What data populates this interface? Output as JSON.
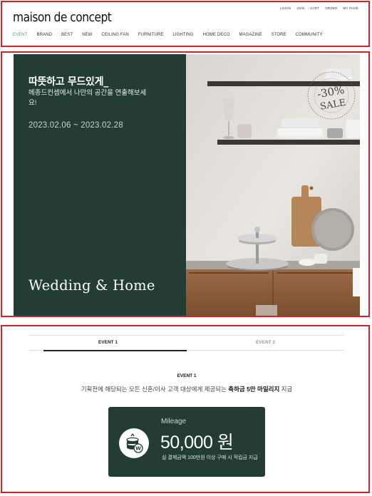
{
  "header": {
    "logo": "maison de concept",
    "utility": [
      "LOGIN",
      "JOIN",
      "CART",
      "ORDER",
      "MY PAGE"
    ],
    "nav": [
      "EVENT",
      "BRAND",
      "BEST",
      "NEW",
      "CEILING FAN",
      "FURNITURE",
      "LIGHTING",
      "HOME DECO",
      "MAGAZINE",
      "STORE",
      "COMMUNITY"
    ],
    "active_nav": "EVENT",
    "accent_color": "#3aa58a"
  },
  "hero": {
    "headline": "따뜻하고 무드있게_",
    "subtext": "메종드컨셉에서 나만의 공간을 연출해보세요!",
    "date": "2023.02.06 ~ 2023.02.28",
    "title": "Wedding & Home",
    "badge_pct": "-30%",
    "badge_sale": "SALE",
    "panel_color": "#233d36"
  },
  "event": {
    "tabs": [
      "EVENT 1",
      "EVENT 2"
    ],
    "active_tab": "EVENT 1",
    "label": "EVENT 1",
    "desc_pre": "기획전에 해당되는 모든 신혼/이사 고객 대상에게 제공되는 ",
    "desc_bold": "축하금 5만 마일리지",
    "desc_post": " 지급",
    "card": {
      "label": "Mileage",
      "amount": "50,000 원",
      "note": "실 결제금액 100만원 이상 구매 시 적립금 지급"
    }
  }
}
